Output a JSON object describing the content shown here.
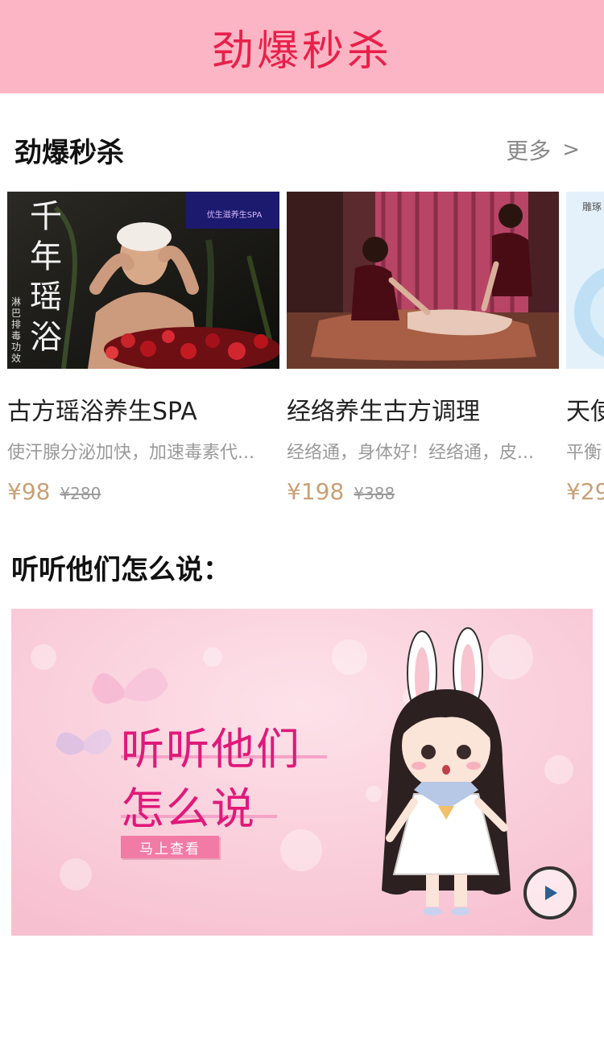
{
  "header": {
    "title": "劲爆秒杀"
  },
  "flash_sale": {
    "title": "劲爆秒杀",
    "more_label": "更多",
    "items": [
      {
        "title": "古方瑶浴养生SPA",
        "desc": "使汗腺分泌加快，加速毒素代...",
        "price": "¥98",
        "original_price": "¥280",
        "image_text": {
          "vertical_title": "千年瑶浴",
          "sub": "淋巴排毒功效",
          "logo": "优生滋养生SPA"
        }
      },
      {
        "title": "经络养生古方调理",
        "desc": "经络通，身体好！经络通，皮...",
        "price": "¥198",
        "original_price": "¥388"
      },
      {
        "title": "天使",
        "desc": "平衡",
        "price": "¥29",
        "original_price": "",
        "image_text": {
          "corner": "雕琢"
        }
      }
    ]
  },
  "testimonials": {
    "title": "听听他们怎么说：",
    "banner": {
      "line1": "听听他们",
      "line2": "怎么说",
      "button": "马上查看"
    }
  },
  "colors": {
    "header_bg": "#fcb5c4",
    "header_text": "#e8204a",
    "price": "#c9a075",
    "banner_text": "#e0197a"
  }
}
